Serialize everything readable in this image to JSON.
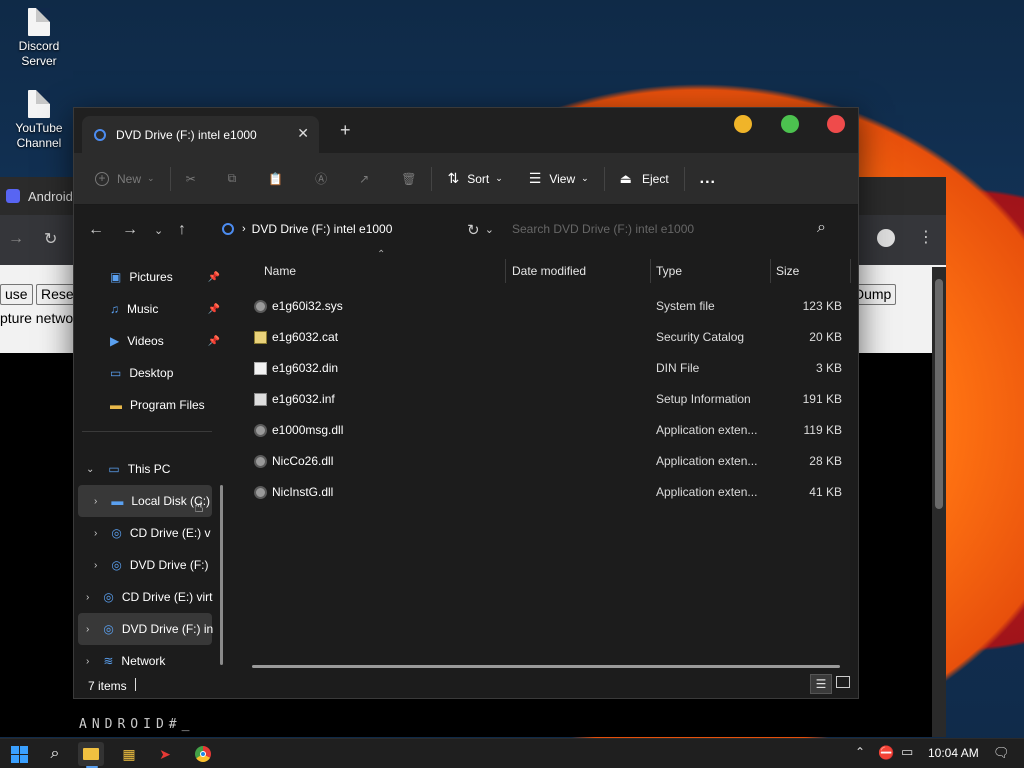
{
  "desktop": {
    "icons": [
      {
        "label": "Discord Server"
      },
      {
        "label": "YouTube Channel"
      }
    ]
  },
  "background_window": {
    "title": "Android",
    "buttons": {
      "left1": "use",
      "left2": "Rese",
      "right": "Dump"
    },
    "link_text": "pture networ",
    "console_text": "ANDROID#_"
  },
  "explorer": {
    "tab_title": "DVD Drive (F:) intel e1000",
    "new_tab": "+",
    "command_bar": {
      "new": "New",
      "sort": "Sort",
      "view": "View",
      "eject": "Eject",
      "more": "..."
    },
    "address": {
      "path": "DVD Drive (F:) intel e1000",
      "search_placeholder": "Search DVD Drive (F:) intel e1000"
    },
    "nav": [
      {
        "label": "Pictures",
        "pinned": true
      },
      {
        "label": "Music",
        "pinned": true
      },
      {
        "label": "Videos",
        "pinned": true
      },
      {
        "label": "Desktop",
        "pinned": false
      },
      {
        "label": "Program Files",
        "pinned": false
      },
      {
        "label": "This PC"
      },
      {
        "label": "Local Disk (C:)"
      },
      {
        "label": "CD Drive (E:) v"
      },
      {
        "label": "DVD Drive (F:)"
      },
      {
        "label": "CD Drive (E:) virt"
      },
      {
        "label": "DVD Drive (F:) in"
      },
      {
        "label": "Network"
      }
    ],
    "columns": {
      "name": "Name",
      "date": "Date modified",
      "type": "Type",
      "size": "Size"
    },
    "files": [
      {
        "name": "e1g60i32.sys",
        "type": "System file",
        "size": "123 KB",
        "icon": "gear-file-icon"
      },
      {
        "name": "e1g6032.cat",
        "type": "Security Catalog",
        "size": "20 KB",
        "icon": "catalog-file-icon"
      },
      {
        "name": "e1g6032.din",
        "type": "DIN File",
        "size": "3 KB",
        "icon": "blank-file-icon"
      },
      {
        "name": "e1g6032.inf",
        "type": "Setup Information",
        "size": "191 KB",
        "icon": "setup-file-icon"
      },
      {
        "name": "e1000msg.dll",
        "type": "Application exten...",
        "size": "119 KB",
        "icon": "gear-file-icon"
      },
      {
        "name": "NicCo26.dll",
        "type": "Application exten...",
        "size": "28 KB",
        "icon": "gear-file-icon"
      },
      {
        "name": "NicInstG.dll",
        "type": "Application exten...",
        "size": "41 KB",
        "icon": "gear-file-icon"
      }
    ],
    "status": "7 items"
  },
  "taskbar": {
    "time": "10:04 AM"
  },
  "colors": {
    "minimize": "#f0b429",
    "maximize": "#4cc24f",
    "close": "#ef4b4b",
    "accent": "#4c8cf0"
  }
}
